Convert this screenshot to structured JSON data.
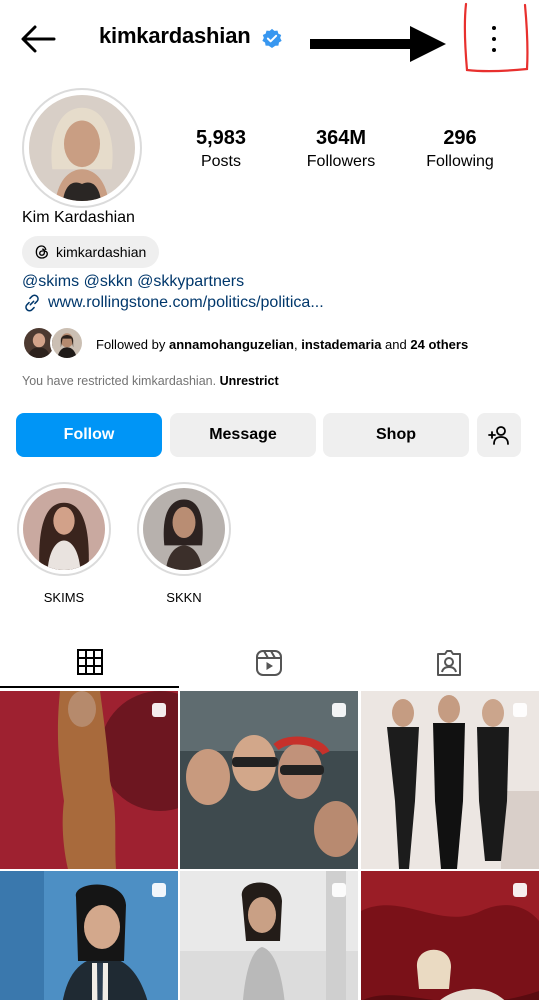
{
  "header": {
    "username": "kimkardashian",
    "back_icon": "back-arrow-icon",
    "verified_icon": "verified-badge-icon",
    "more_icon": "more-vertical-icon",
    "verified_color": "#3897f0"
  },
  "profile": {
    "full_name": "Kim Kardashian",
    "threads_handle": "kimkardashian",
    "bio_mentions": "@skims @skkn @skkypartners",
    "bio_link": "www.rollingstone.com/politics/politica...",
    "link_color": "#00376b"
  },
  "stats": [
    {
      "value": "5,983",
      "label": "Posts"
    },
    {
      "value": "364M",
      "label": "Followers"
    },
    {
      "value": "296",
      "label": "Following"
    }
  ],
  "followed_by": {
    "prefix": "Followed by",
    "user1": "annamohanguzelian",
    "separator": ",",
    "user2": "instademaria",
    "and": "and",
    "others": "24 others"
  },
  "restricted": {
    "text": "You have restricted kimkardashian.",
    "action": "Unrestrict"
  },
  "buttons": {
    "follow": "Follow",
    "message": "Message",
    "shop": "Shop",
    "add_user_icon": "add-user-icon",
    "follow_color": "#0095f6"
  },
  "highlights": [
    {
      "label": "SKIMS"
    },
    {
      "label": "SKKN"
    }
  ],
  "tabs": [
    {
      "icon": "grid-icon",
      "active": true
    },
    {
      "icon": "reels-icon",
      "active": false
    },
    {
      "icon": "tagged-icon",
      "active": false
    }
  ],
  "posts": {
    "count_visible": 6,
    "multi_icon": "carousel-icon"
  }
}
